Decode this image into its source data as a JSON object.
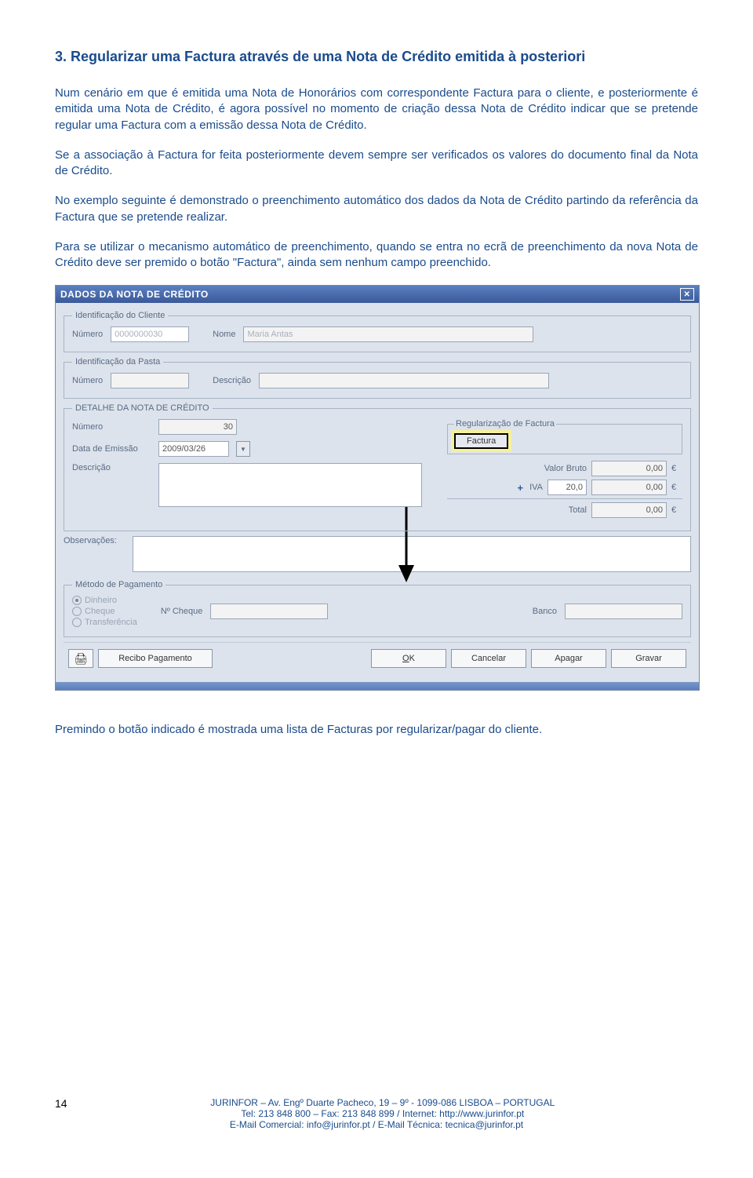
{
  "section": {
    "title": "3. Regularizar uma Factura através de uma Nota de Crédito emitida à posteriori",
    "p1": "Num cenário em que é emitida uma Nota de Honorários com correspondente Factura para o cliente, e posteriormente é emitida uma Nota de Crédito, é agora possível no momento de criação dessa Nota de Crédito indicar que se pretende regular uma Factura com a emissão dessa Nota de Crédito.",
    "p2": "Se a associação à Factura for feita posteriormente devem sempre ser verificados os valores do documento final da Nota de Crédito.",
    "p3": "No exemplo seguinte é demonstrado o preenchimento automático dos dados da Nota de Crédito partindo da referência da Factura que se pretende realizar.",
    "p4": "Para se utilizar o mecanismo automático de preenchimento, quando se entra no ecrã de preenchimento da nova Nota de Crédito deve ser premido o botão \"Factura\", ainda sem nenhum campo preenchido.",
    "p5": "Premindo o botão indicado é mostrada uma lista de Facturas por regularizar/pagar do cliente."
  },
  "dialog": {
    "title": "DADOS DA NOTA DE CRÉDITO",
    "close": "✕",
    "client": {
      "legend": "Identificação do Cliente",
      "numero_lbl": "Número",
      "numero_val": "0000000030",
      "nome_lbl": "Nome",
      "nome_val": "Maria Antas"
    },
    "pasta": {
      "legend": "Identificação da Pasta",
      "numero_lbl": "Número",
      "desc_lbl": "Descrição"
    },
    "detail": {
      "legend": "DETALHE DA NOTA DE CRÉDITO",
      "numero_lbl": "Número",
      "numero_val": "30",
      "data_lbl": "Data de Emissão",
      "data_val": "2009/03/26",
      "desc_lbl": "Descrição",
      "regula_legend": "Regularização de Factura",
      "factura_btn": "Factura",
      "valor_bruto_lbl": "Valor Bruto",
      "valor_bruto_val": "0,00",
      "iva_lbl": "IVA",
      "iva_rate": "20,0",
      "iva_val": "0,00",
      "total_lbl": "Total",
      "total_val": "0,00",
      "euro": "€",
      "plus": "+"
    },
    "obs_lbl": "Observações:",
    "pay": {
      "legend": "Método de Pagamento",
      "dinheiro": "Dinheiro",
      "cheque": "Cheque",
      "transfer": "Transferência",
      "ncheque_lbl": "Nº Cheque",
      "banco_lbl": "Banco"
    },
    "actions": {
      "recibo": "Recibo Pagamento",
      "ok": "OK",
      "cancelar": "Cancelar",
      "apagar": "Apagar",
      "gravar": "Gravar"
    }
  },
  "footer": {
    "page_num": "14",
    "line1": "JURINFOR – Av. Engº Duarte Pacheco, 19 – 9º - 1099-086 LISBOA – PORTUGAL",
    "line2": "Tel: 213 848 800 – Fax: 213 848 899 / Internet: http://www.jurinfor.pt",
    "line3": "E-Mail Comercial: info@jurinfor.pt / E-Mail Técnica: tecnica@jurinfor.pt"
  }
}
